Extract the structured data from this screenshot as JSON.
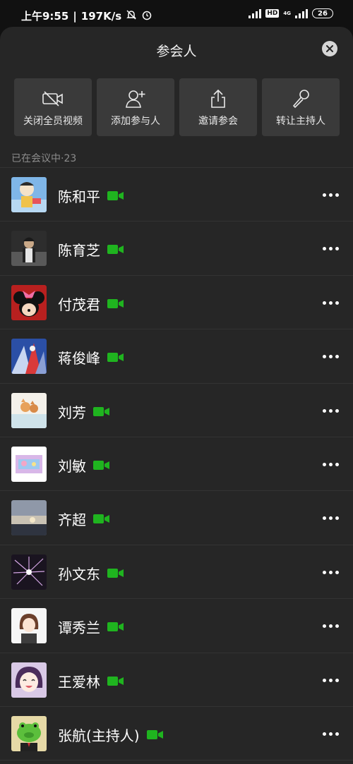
{
  "status_bar": {
    "time": "上午9:55",
    "speed": "197K/s",
    "hd": "HD",
    "network": "4G",
    "battery": "26"
  },
  "sheet": {
    "title": "参会人",
    "close_icon": "close-icon"
  },
  "actions": [
    {
      "label": "关闭全员视频",
      "icon": "video-off-icon"
    },
    {
      "label": "添加参与人",
      "icon": "add-person-icon"
    },
    {
      "label": "邀请参会",
      "icon": "share-icon"
    },
    {
      "label": "转让主持人",
      "icon": "microphone-icon"
    }
  ],
  "section": {
    "label": "已在会议中·23"
  },
  "participants": [
    {
      "name": "陈和平",
      "camera": "video-on-icon"
    },
    {
      "name": "陈育芝",
      "camera": "video-on-icon"
    },
    {
      "name": "付茂君",
      "camera": "video-on-icon"
    },
    {
      "name": "蒋俊峰",
      "camera": "video-on-icon"
    },
    {
      "name": "刘芳",
      "camera": "video-on-icon"
    },
    {
      "name": "刘敏",
      "camera": "video-on-icon"
    },
    {
      "name": "齐超",
      "camera": "video-on-icon"
    },
    {
      "name": "孙文东",
      "camera": "video-on-icon"
    },
    {
      "name": "谭秀兰",
      "camera": "video-on-icon"
    },
    {
      "name": "王爱林",
      "camera": "video-on-icon"
    },
    {
      "name": "张航(主持人)",
      "camera": "video-on-icon"
    }
  ],
  "colors": {
    "background": "#262626",
    "action_bg": "#3a3a3a",
    "camera_green": "#1fb41f",
    "muted_text": "#8c8c8c"
  }
}
